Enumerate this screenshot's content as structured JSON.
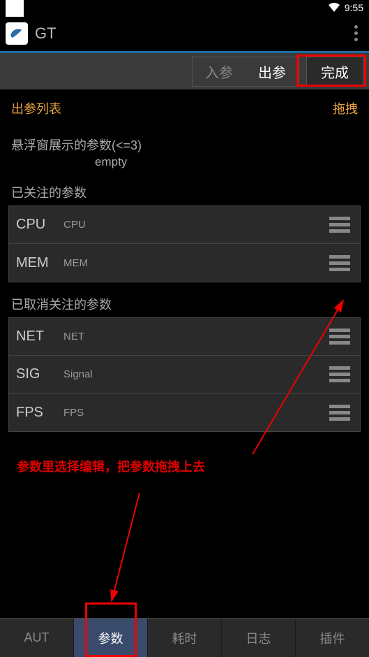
{
  "status": {
    "time": "9:55"
  },
  "header": {
    "app_title": "GT"
  },
  "toolbar": {
    "tab_in": "入参",
    "tab_out": "出参",
    "done_label": "完成"
  },
  "list": {
    "title": "出参列表",
    "drag_label": "拖拽"
  },
  "sections": {
    "float_label": "悬浮窗展示的参数(<=3)",
    "empty_text": "empty",
    "followed_label": "已关注的参数",
    "followed": [
      {
        "name": "CPU",
        "desc": "CPU"
      },
      {
        "name": "MEM",
        "desc": "MEM"
      }
    ],
    "unfollowed_label": "已取消关注的参数",
    "unfollowed": [
      {
        "name": "NET",
        "desc": "NET"
      },
      {
        "name": "SIG",
        "desc": "Signal"
      },
      {
        "name": "FPS",
        "desc": "FPS"
      }
    ]
  },
  "instruction": "参数里选择编辑，把参数拖拽上去",
  "nav": {
    "items": [
      "AUT",
      "参数",
      "耗时",
      "日志",
      "插件"
    ],
    "active": 1
  }
}
